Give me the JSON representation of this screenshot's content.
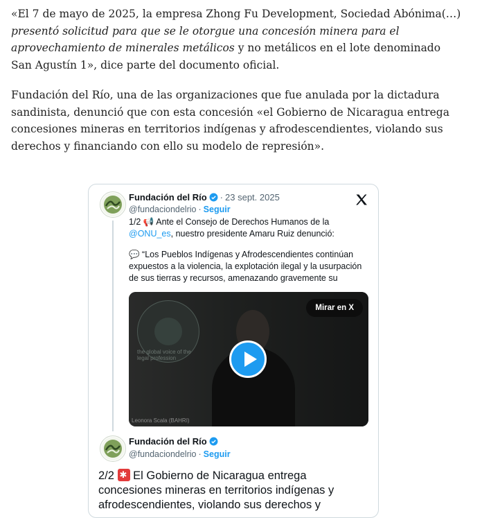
{
  "article": {
    "p1_a": "«El 7 de mayo de 2025, la empresa Zhong Fu Development, Sociedad Abónima(…) ",
    "p1_em": "presentó solicitud para que se le otorgue una concesión minera para el aprovechamiento de minerales metálicos",
    "p1_b": " y no metálicos en el lote denominado San Agustín 1», dice parte del documento oficial.",
    "p2": "Fundación del Río, una de las organizaciones que fue anulada por la dictadura sandinista, denunció que con esta concesión «el Gobierno de Nicaragua entrega concesiones mineras en territorios indígenas y afrodescendientes, violando sus derechos y financiando con ello su modelo de represión»."
  },
  "tweet1": {
    "name": "Fundación del Río",
    "date": "23 sept. 2025",
    "handle": "@fundaciondelrio",
    "follow": "Seguir",
    "line1_prefix": "1/2",
    "line1_text": " Ante el Consejo de Derechos Humanos de la",
    "mention": "@ONU_es",
    "line1_suffix": ", nuestro presidente Amaru Ruiz denunció:",
    "quote": " “Los Pueblos Indígenas y Afrodescendientes continúan expuestos a la violencia, la explotación ilegal y la usurpación de sus tierras y recursos, amenazando gravemente su",
    "video": {
      "watch_label": "Mirar en X",
      "org_caption": "the global voice of the legal profession",
      "speaker": "Leonora Scala (BAHRI)"
    }
  },
  "tweet2": {
    "name": "Fundación del Río",
    "handle": "@fundaciondelrio",
    "follow": "Seguir",
    "prefix": "2/2",
    "text": " El Gobierno de Nicaragua entrega concesiones mineras en territorios indígenas y afrodescendientes, violando sus derechos y"
  },
  "icons": {
    "verified": "verified-badge-icon",
    "x_logo": "x-logo-icon",
    "play": "play-icon",
    "megaphone": "megaphone-emoji",
    "speech": "speech-bubble-emoji",
    "siren": "siren-emoji"
  },
  "colors": {
    "link": "#1d9bf0",
    "text": "#0f1419",
    "muted": "#536471",
    "border": "#cfd9de"
  }
}
